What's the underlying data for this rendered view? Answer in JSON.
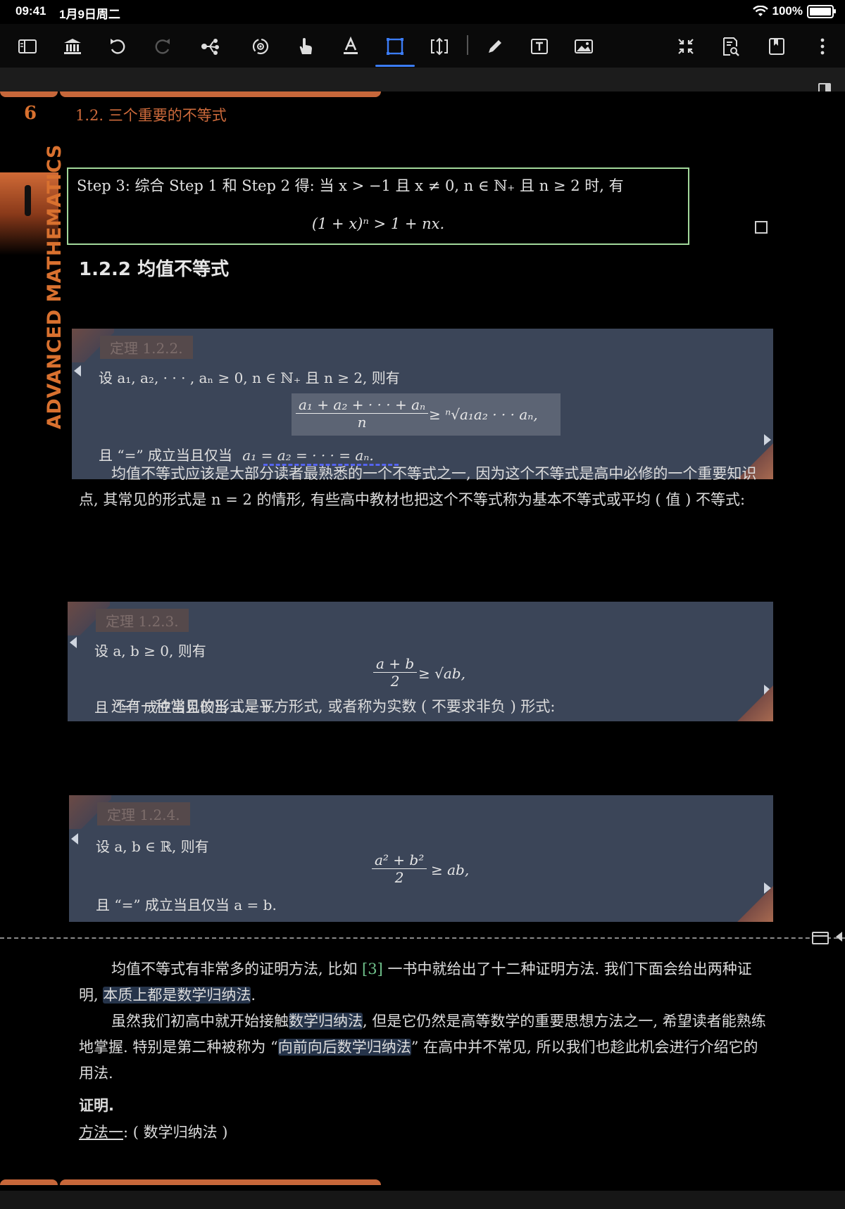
{
  "status": {
    "time": "09:41",
    "date": "1月9日周二",
    "battery": "100%"
  },
  "toolbar": {
    "icons": [
      "sidebar-icon",
      "library-icon",
      "undo-icon",
      "redo-icon",
      "share-tree-icon",
      "rotate-icon",
      "hand-icon",
      "text-style-icon",
      "select-rect-icon",
      "resize-icon",
      "pen-icon",
      "textbox-icon",
      "image-icon",
      "collapse-icon",
      "search-doc-icon",
      "bookmark-icon",
      "more-icon"
    ],
    "active": "select-rect-icon",
    "accent": "#3b7cf5"
  },
  "page": {
    "number": "6",
    "running_head": "1.2.   三个重要的不等式",
    "side_title": "ADVANCED MATHEMATICS",
    "accent": "#d9712f"
  },
  "step3": {
    "text": "Step 3:  综合 Step 1 和 Step 2 得: 当 x > −1 且 x ≠ 0, n ∈ ℕ₊ 且 n ≥ 2 时, 有",
    "formula": "(1 + x)ⁿ > 1 + nx."
  },
  "section": {
    "title": "1.2.2   均值不等式"
  },
  "thm122": {
    "label": "定理 1.2.2.",
    "line1": "设 a₁, a₂, · · · , aₙ ≥ 0, n ∈ ℕ₊ 且 n ≥ 2, 则有",
    "frac_num": "a₁ + a₂ + · · · + aₙ",
    "frac_den": "n",
    "rhs": "≥ ⁿ√a₁a₂ · · · aₙ,",
    "line3_prefix": "且 “=” 成立当且仅当",
    "line3_eq": "a₁ = a₂ = · · · = aₙ."
  },
  "para1": {
    "text": "均值不等式应该是大部分读者最熟悉的一个不等式之一, 因为这个不等式是高中必修的一个重要知识点, 其常见的形式是 n = 2 的情形, 有些高中教材也把这个不等式称为基本不等式或平均 ( 值 ) 不等式:"
  },
  "thm123": {
    "label": "定理 1.2.3.",
    "line1": "设 a, b ≥ 0, 则有",
    "frac_num": "a + b",
    "frac_den": "2",
    "rhs": "≥ √ab,",
    "line3": "且 “=” 成立当且仅当 a = b."
  },
  "para2": {
    "text": "还有一种常见的形式是平方形式, 或者称为实数 ( 不要求非负 ) 形式:"
  },
  "thm124": {
    "label": "定理 1.2.4.",
    "line1": "设 a, b ∈ ℝ, 则有",
    "frac_num": "a² + b²",
    "frac_den": "2",
    "rhs": "≥ ab,",
    "line3": "且 “=” 成立当且仅当 a = b."
  },
  "para3": {
    "a": "均值不等式有非常多的证明方法, 比如 ",
    "ref": "[3]",
    "b": " 一书中就给出了十二种证明方法. 我们下面会给出两种证明, ",
    "hl": "本质上都是数学归纳法",
    "c": "."
  },
  "para4": {
    "a": "虽然我们初高中就开始接触",
    "hl1": "数学归纳法",
    "b": ", 但是它仍然是高等数学的重要思想方法之一, 希望读者能熟练地掌握. 特别是第二种被称为 “",
    "hl2": "向前向后数学归纳法",
    "c": "” 在高中并不常见, 所以我们也趁此机会进行介绍它的用法."
  },
  "proof": {
    "title": "证明.",
    "method_label": "方法一",
    "method_rest": ": ( 数学归纳法 )"
  }
}
